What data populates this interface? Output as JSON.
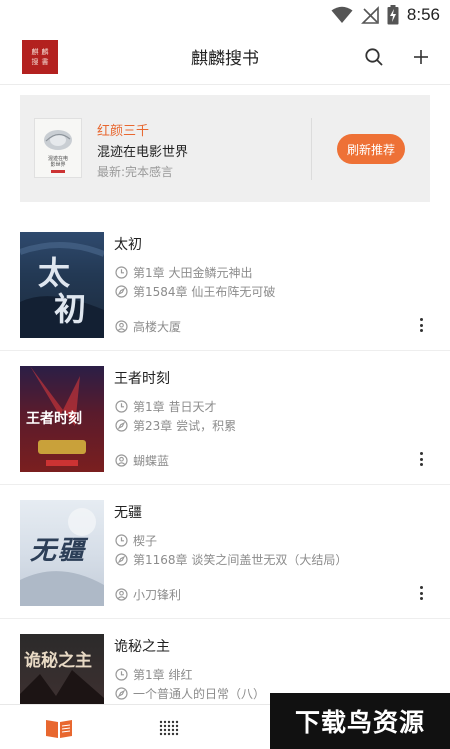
{
  "status_bar": {
    "time": "8:56",
    "icons": [
      "wifi-icon",
      "no-signal-icon",
      "battery-charging-icon"
    ]
  },
  "header": {
    "logo_text": [
      "麒",
      "麟",
      "搜",
      "書"
    ],
    "title": "麒麟搜书",
    "search_icon": "search-icon",
    "add_icon": "plus-icon"
  },
  "banner": {
    "cover_text": [
      "混迹在电",
      "影世界"
    ],
    "author": "红颜三千",
    "title": "混迹在电影世界",
    "latest": "最新:完本感言",
    "refresh_label": "刷新推荐"
  },
  "books": [
    {
      "title": "太初",
      "latest_read": "第1章 大田金鳞元神出",
      "latest_chapter": "第1584章 仙王布阵无可破",
      "author": "高楼大厦",
      "cover_chars": "太初"
    },
    {
      "title": "王者时刻",
      "latest_read": "第1章 昔日天才",
      "latest_chapter": "第23章 尝试，积累",
      "author": "蝴蝶蓝",
      "cover_chars": "王者时刻"
    },
    {
      "title": "无疆",
      "latest_read": "楔子",
      "latest_chapter": "第1168章 谈笑之间盖世无双（大结局）",
      "author": "小刀锋利",
      "cover_chars": "无疆"
    },
    {
      "title": "诡秘之主",
      "latest_read": "第1章 绯红",
      "latest_chapter": "一个普通人的日常（八）",
      "author": "",
      "cover_chars": "诡秘之主"
    }
  ],
  "bottom_nav": {
    "tabs": [
      {
        "icon": "book-icon",
        "active": true,
        "color": "#e8672f"
      },
      {
        "icon": "dot-grid-icon",
        "active": false,
        "color": "#333333"
      }
    ]
  },
  "watermark": "下载鸟资源",
  "colors": {
    "accent": "#ee7136",
    "author_orange": "#e8672f",
    "logo_red": "#b3211f",
    "banner_bg": "#efefef"
  }
}
